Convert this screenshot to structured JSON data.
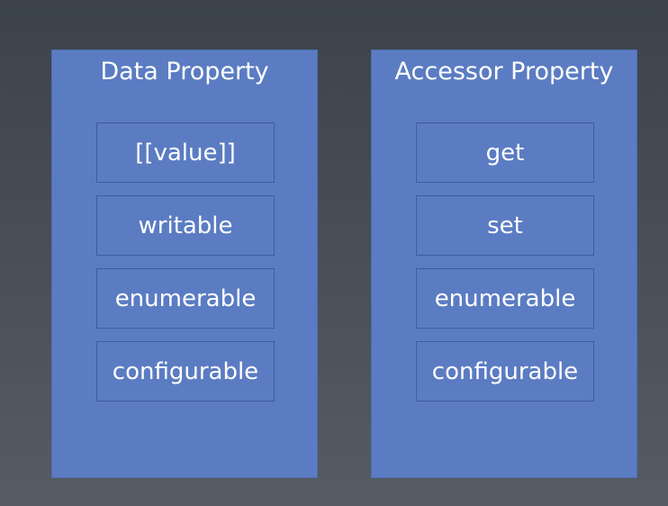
{
  "panels": [
    {
      "title": "Data Property",
      "attributes": [
        "[[value]]",
        "writable",
        "enumerable",
        "configurable"
      ]
    },
    {
      "title": "Accessor Property",
      "attributes": [
        "get",
        "set",
        "enumerable",
        "configurable"
      ]
    }
  ],
  "colors": {
    "panel_fill": "#5b7cc2",
    "box_border": "#3f5d9c",
    "text": "#ffffff",
    "background_top": "#3c434c",
    "background_bottom": "#565c63"
  }
}
